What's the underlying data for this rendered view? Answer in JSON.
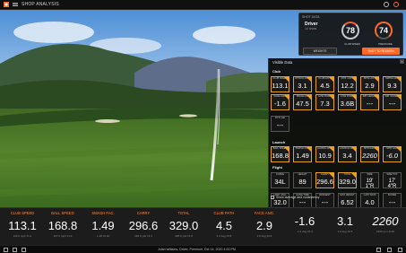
{
  "app": {
    "title": "SHOP ANALYSIS"
  },
  "summary": {
    "label": "SHOT DATA",
    "club": "Driver",
    "sub": "14 shots",
    "gauge1_value": "78",
    "gauge1_label": "CLUB SPEED",
    "gauge2_value": "74",
    "gauge2_label": "PRESSURE",
    "btn_left": "WEIGHTS",
    "btn_right": "SHOT TO SESSION"
  },
  "panel": {
    "title": "Visible Data",
    "close": "×",
    "sections": {
      "club": "Club",
      "launch": "Launch",
      "flight": "Flight"
    },
    "club_row1": [
      {
        "label": "CLUB SPEED",
        "value": "113.1"
      },
      {
        "label": "ATTACK ANG.",
        "value": "3.1"
      },
      {
        "label": "CLUB PATH",
        "value": "4.5"
      },
      {
        "label": "DYN. LOFT",
        "value": "12.2"
      },
      {
        "label": "SPIN LOFT",
        "value": "2.9"
      },
      {
        "label": "SWING DIR.",
        "value": "9.3"
      }
    ],
    "club_row2": [
      {
        "label": "FACE ANG.",
        "value": "-1.6"
      },
      {
        "label": "SWING PL.",
        "value": "47.5"
      },
      {
        "label": "LOW POINT",
        "value": "7.3"
      },
      {
        "label": "LOW POINT",
        "value": "3.6B"
      },
      {
        "label": "IMP. HEIGHT",
        "value": "---"
      },
      {
        "label": "IMP. OFFSET",
        "value": "---"
      }
    ],
    "club_row3": [
      {
        "label": "DYN. LIE",
        "value": "---"
      }
    ],
    "launch_row": [
      {
        "label": "BALL SPEED",
        "value": "168.8"
      },
      {
        "label": "SMASH FAC.",
        "value": "1.49"
      },
      {
        "label": "LAUNCH ANG.",
        "value": "10.9"
      },
      {
        "label": "LAUNCH DIR.",
        "value": "3.4"
      },
      {
        "label": "SPIN RATE",
        "value": "2260"
      },
      {
        "label": "SPIN AXIS",
        "value": "-6.0"
      }
    ],
    "flight_row1": [
      {
        "label": "CURVE",
        "value": "34L"
      },
      {
        "label": "HEIGHT",
        "value": "89"
      },
      {
        "label": "CARRY",
        "value": "296.6"
      },
      {
        "label": "TOTAL",
        "value": "329.0"
      },
      {
        "label": "SIDE",
        "value": "19' 1\"R"
      },
      {
        "label": "SIDE TOT.",
        "value": "17' 4\"R"
      }
    ],
    "flight_row2": [
      {
        "label": "LAND. ANG.",
        "value": "32.0"
      },
      {
        "label": "HANG TIME",
        "value": "---"
      },
      {
        "label": "DESCENT",
        "value": "---"
      },
      {
        "label": "MAX HEIGHT",
        "value": "6.52"
      },
      {
        "label": "LAST DATA",
        "value": "4.0"
      },
      {
        "label": "SCORE",
        "value": "---"
      }
    ],
    "checkbox_label": "Show average and consistency"
  },
  "bottom": [
    {
      "label": "CLUB SPEED",
      "value": "113.1",
      "sub": "113.0  mph  ±1.2"
    },
    {
      "label": "BALL SPEED",
      "value": "168.8",
      "sub": "167.0  mph  ±1.4"
    },
    {
      "label": "SMASH FAC.",
      "value": "1.49",
      "sub": "1.48  ±0.02"
    },
    {
      "label": "CARRY",
      "value": "296.6",
      "sub": "294.0  yds  ±3.4"
    },
    {
      "label": "TOTAL",
      "value": "329.0",
      "sub": "328.0  yds  ±4.8"
    },
    {
      "label": "CLUB PATH",
      "value": "4.5",
      "sub": "4.2  deg  ±0.8"
    },
    {
      "label": "FACE ANG.",
      "value": "2.9",
      "sub": "2.8  deg  ±0.6"
    },
    {
      "label": "",
      "value": "-1.6",
      "sub": "-1.4  deg  ±0.4"
    },
    {
      "label": "",
      "value": "3.1",
      "sub": "3.0  deg  ±0.5"
    },
    {
      "label": "",
      "value": "2260",
      "sub": "2400  rpm  ±120"
    }
  ],
  "footer": {
    "info": "Jolan williams, Driver, Premium, Oct 14, 2020 4:53 PM"
  },
  "colors": {
    "accent": "#ff8a3a",
    "tile_border": "#e8a020"
  }
}
